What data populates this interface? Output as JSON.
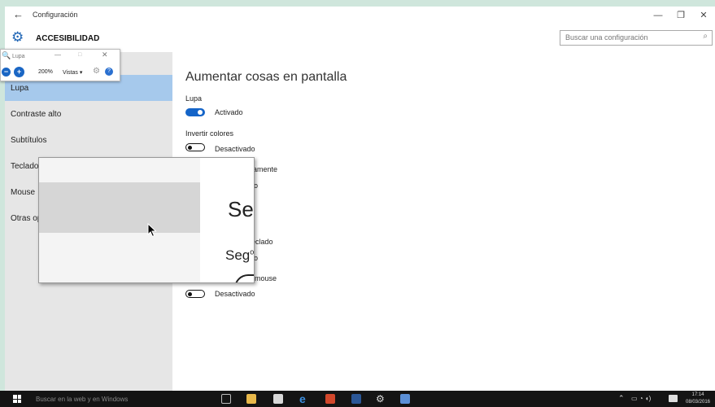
{
  "titlebar": {
    "back_icon": "back-arrow-icon",
    "title": "Configuración",
    "minimize_label": "—",
    "restore_label": "❐",
    "close_label": "✕"
  },
  "header": {
    "icon": "gear-icon",
    "title": "ACCESIBILIDAD",
    "search_placeholder": "Buscar una configuración",
    "search_icon": "search-icon"
  },
  "sidebar": {
    "items": [
      {
        "label": "Lupa"
      },
      {
        "label": "Contraste alto"
      },
      {
        "label": "Subtítulos"
      },
      {
        "label": "Teclado"
      },
      {
        "label": "Mouse"
      },
      {
        "label": "Otras op"
      }
    ],
    "selected_index": 0
  },
  "main": {
    "heading": "Aumentar cosas en pantalla",
    "lupa_label": "Lupa",
    "lupa_toggle": "Activado",
    "invert_label": "Invertir colores",
    "invert_toggle": "Desactivado",
    "frag_auto": "ticamente",
    "frag_o1": "o",
    "frag_teclado": "eclado",
    "frag_o2": "o",
    "frag_mouse": "mouse",
    "mouse_toggle": "Desactivado"
  },
  "lupa_window": {
    "title": "Lupa",
    "minimize_label": "—",
    "maximize_label": "□",
    "close_label": "✕",
    "zoom": "200%",
    "views_label": "Vistas ▾",
    "zoom_out_label": "−",
    "zoom_in_label": "+",
    "help_label": "?"
  },
  "magnifier": {
    "big_text": "Se",
    "medium_text": "Seg",
    "small_fragment": "o"
  },
  "taskbar": {
    "search_placeholder": "Buscar en la web y en Windows",
    "time": "17:14",
    "date": "08/03/2016"
  },
  "colors": {
    "accent": "#1464c8",
    "selected_nav": "#a6c9ec",
    "sidebar_bg": "#e6e6e6",
    "taskbar": "#141414",
    "desktop": "#cfe6dc"
  }
}
